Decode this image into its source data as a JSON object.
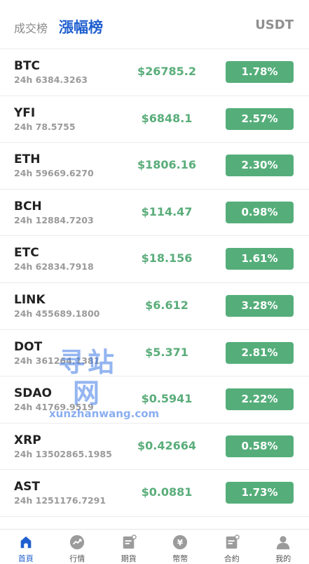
{
  "header": {
    "tab_volume": "成交榜",
    "tab_gainers": "漲幅榜",
    "quote": "USDT"
  },
  "rows": [
    {
      "symbol": "BTC",
      "volume": "24h 6384.3263",
      "price": "$26785.2",
      "change": "1.78%"
    },
    {
      "symbol": "YFI",
      "volume": "24h 78.5755",
      "price": "$6848.1",
      "change": "2.57%"
    },
    {
      "symbol": "ETH",
      "volume": "24h 59669.6270",
      "price": "$1806.16",
      "change": "2.30%"
    },
    {
      "symbol": "BCH",
      "volume": "24h 12884.7203",
      "price": "$114.47",
      "change": "0.98%"
    },
    {
      "symbol": "ETC",
      "volume": "24h 62834.7918",
      "price": "$18.156",
      "change": "1.61%"
    },
    {
      "symbol": "LINK",
      "volume": "24h 455689.1800",
      "price": "$6.612",
      "change": "3.28%"
    },
    {
      "symbol": "DOT",
      "volume": "24h 361264.1381",
      "price": "$5.371",
      "change": "2.81%"
    },
    {
      "symbol": "SDAO",
      "volume": "24h 41769.9519",
      "price": "$0.5941",
      "change": "2.22%"
    },
    {
      "symbol": "XRP",
      "volume": "24h 13502865.1985",
      "price": "$0.42664",
      "change": "0.58%"
    },
    {
      "symbol": "AST",
      "volume": "24h 1251176.7291",
      "price": "$0.0881",
      "change": "1.73%"
    }
  ],
  "watermark": {
    "cn": "寻站网",
    "en": "xunzhanwang.com"
  },
  "tabbar": [
    {
      "label": "首頁",
      "icon": "home-icon",
      "active": true
    },
    {
      "label": "行情",
      "icon": "trend-icon",
      "active": false
    },
    {
      "label": "期貨",
      "icon": "futures-icon",
      "active": false
    },
    {
      "label": "幣幣",
      "icon": "coin-icon",
      "active": false
    },
    {
      "label": "合約",
      "icon": "contract-icon",
      "active": false
    },
    {
      "label": "我的",
      "icon": "user-icon",
      "active": false
    }
  ],
  "colors": {
    "accent": "#1f5fcf",
    "up": "#55ae7a",
    "muted": "#9a9a9a"
  }
}
